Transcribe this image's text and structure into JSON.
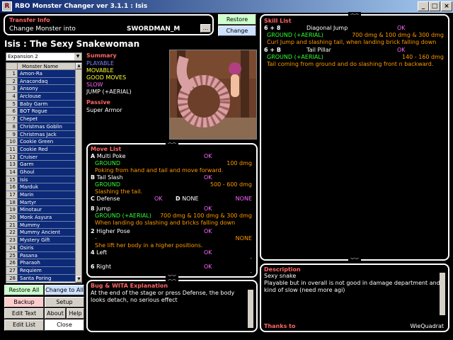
{
  "window": {
    "title": "RBO Monster Changer ver 3.1.1 : Isis",
    "min": "_",
    "max": "□",
    "close": "×",
    "app_glyph": "R"
  },
  "transfer": {
    "title": "Transfer Info",
    "label": "Change Monster into",
    "value": "SWORDMAN_M",
    "browse": "..."
  },
  "actions": {
    "restore": "Restore",
    "change": "Change"
  },
  "monster_heading": "Isis : The Sexy Snakewoman",
  "expansion": {
    "selected": "Expansion 2"
  },
  "list": {
    "header": "Monster Name",
    "items": [
      {
        "n": "1",
        "name": "Amon-Ra"
      },
      {
        "n": "2",
        "name": "Anacondaq"
      },
      {
        "n": "3",
        "name": "Ansony"
      },
      {
        "n": "4",
        "name": "Arclouse"
      },
      {
        "n": "5",
        "name": "Baby Garm"
      },
      {
        "n": "6",
        "name": "BOT Rogue"
      },
      {
        "n": "7",
        "name": "Chepet"
      },
      {
        "n": "8",
        "name": "Christmas Goblin"
      },
      {
        "n": "9",
        "name": "Christmas Jack"
      },
      {
        "n": "10",
        "name": "Cookie Green"
      },
      {
        "n": "11",
        "name": "Cookie Red"
      },
      {
        "n": "12",
        "name": "Cruiser"
      },
      {
        "n": "13",
        "name": "Garm"
      },
      {
        "n": "14",
        "name": "Ghoul"
      },
      {
        "n": "15",
        "name": "Isis"
      },
      {
        "n": "16",
        "name": "Marduk"
      },
      {
        "n": "17",
        "name": "Marin"
      },
      {
        "n": "18",
        "name": "Martyr"
      },
      {
        "n": "19",
        "name": "Minotaur"
      },
      {
        "n": "20",
        "name": "Monk Asyura"
      },
      {
        "n": "21",
        "name": "Mummy"
      },
      {
        "n": "22",
        "name": "Mummy Ancient"
      },
      {
        "n": "23",
        "name": "Mystery Gift"
      },
      {
        "n": "24",
        "name": "Osiris"
      },
      {
        "n": "25",
        "name": "Pasana"
      },
      {
        "n": "26",
        "name": "Pharaoh"
      },
      {
        "n": "27",
        "name": "Requiem"
      },
      {
        "n": "28",
        "name": "Santa Poring"
      }
    ]
  },
  "buttons": {
    "restore_all": "Restore All Job",
    "change_all": "Change to All",
    "backup": "Backup",
    "setup": "Setup",
    "edit_text": "Edit Text",
    "about": "About",
    "help": "Help",
    "edit_list": "Edit List",
    "close": "Close"
  },
  "summary": {
    "title": "Summary",
    "items": [
      "PLAYABLE",
      "MOVABLE",
      "GOOD MOVES",
      "SLOW",
      "JUMP (+AERIAL)"
    ],
    "passive_title": "Passive",
    "passive": "Super Armor"
  },
  "move_list": {
    "title": "Move List",
    "moves": [
      {
        "key": "A",
        "name": "Multi Poke",
        "ok": "OK",
        "type": "GROUND",
        "dmg": "100 dmg",
        "desc": "Poking from hand and tail and move forward."
      },
      {
        "key": "B",
        "name": "Tail Slash",
        "ok": "OK",
        "type": "GROUND",
        "dmg": "500 - 600 dmg",
        "desc": "Slashing the tail."
      },
      {
        "key": "C",
        "name": "Defense",
        "ok": "OK",
        "key2": "D",
        "name2": "NONE",
        "none": "NONE"
      },
      {
        "key": "8",
        "name": "Jump",
        "ok": "OK",
        "type": "GROUND (+AERIAL)",
        "dmg": "700 dmg & 100 dmg & 300 dmg",
        "desc": "When landing do slashing and bricks falling down"
      },
      {
        "key": "2",
        "name": "Higher Pose",
        "ok": "OK",
        "type": "-",
        "dmg": "NONE",
        "desc": "She lift her body in a higher positions."
      },
      {
        "key": "4",
        "name": "Left",
        "ok": "OK",
        "dot": "."
      },
      {
        "key": "6",
        "name": "Right",
        "ok": "OK",
        "dot": "."
      }
    ]
  },
  "skill_list": {
    "title": "Skill List",
    "skills": [
      {
        "key": "6 + 8",
        "name": "Diagonal Jump",
        "ok": "OK",
        "type": "GROUND (+AERIAL)",
        "dmg": "700 dmg & 100 dmg & 300 dmg",
        "desc": "Curl Jump and slashing tail, when landing brick falling down"
      },
      {
        "key": "6 + B",
        "name": "Tail Pillar",
        "ok": "OK",
        "type": "GROUND (+AERIAL)",
        "dmg": "140 - 160 dmg",
        "desc": "Tail coming from ground and do slashing front n backward."
      }
    ]
  },
  "bug": {
    "title": "Bug & WITA Explanation",
    "text": "At the end of the stage or press Defense, the body looks detach, no serious effect"
  },
  "description": {
    "title": "Description",
    "text": "Sexy snake\nPlayable but in overall is not good in damage department and kind of slow (need more agi)",
    "thanks_title": "Thanks to",
    "thanks": "WieQuadrat"
  },
  "colors": {
    "accent": "#ff6666",
    "ground": "#33ff33",
    "dmg": "#ff9900",
    "ok": "#ff66ff",
    "desc": "#ffff33",
    "list_bg": "#0d2a78"
  }
}
